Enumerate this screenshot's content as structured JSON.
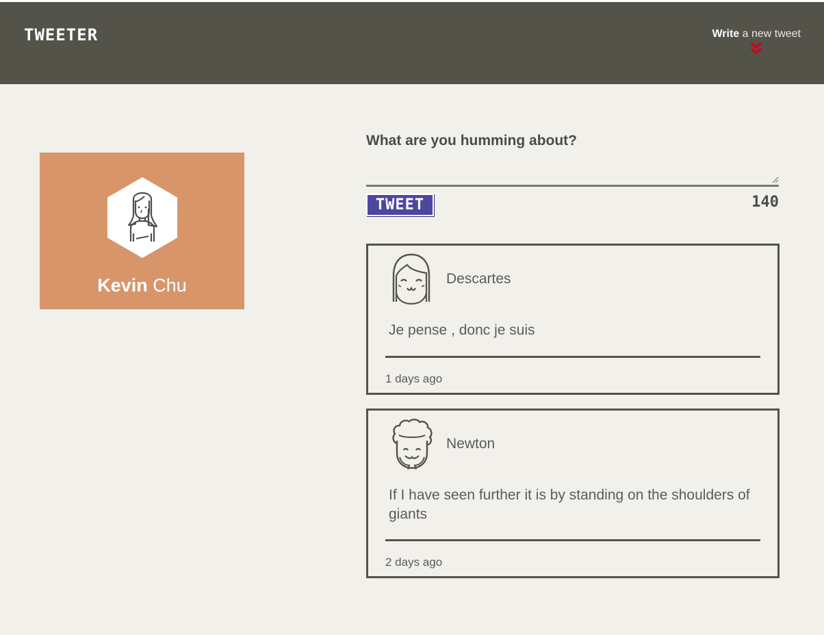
{
  "nav": {
    "brand": "TWEETER",
    "compose_bold": "Write",
    "compose_rest": " a new tweet",
    "compose_icon": "double-chevron-down-icon",
    "accent_color": "#d0021b"
  },
  "profile": {
    "first_name": "Kevin",
    "last_name": " Chu",
    "avatar_icon": "girl-avatar-icon",
    "card_color": "#d8956a"
  },
  "composer": {
    "prompt": "What are you humming about?",
    "input_value": "",
    "input_placeholder": "",
    "button_label": "TWEET",
    "button_color": "#4e47a0",
    "char_count": "140"
  },
  "tweets": [
    {
      "author": "Descartes",
      "avatar_icon": "girl-bangs-avatar-icon",
      "text": "Je pense , donc je suis",
      "time": "1 days ago"
    },
    {
      "author": "Newton",
      "avatar_icon": "curly-hair-avatar-icon",
      "text": "If I have seen further it is by standing on the shoulders of giants",
      "time": "2 days ago"
    }
  ]
}
